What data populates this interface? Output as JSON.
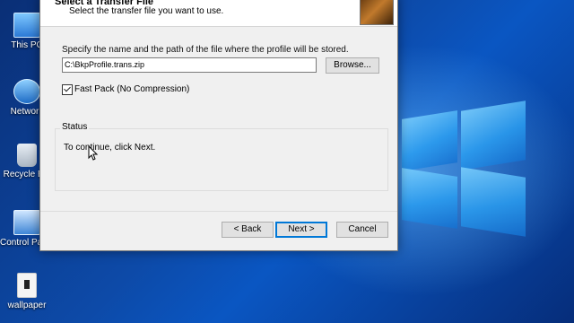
{
  "desktop": {
    "icons": [
      {
        "label": "This PC"
      },
      {
        "label": "Network"
      },
      {
        "label": "Recycle Bin"
      },
      {
        "label": "Control Panel"
      },
      {
        "label": "wallpaper"
      }
    ]
  },
  "dialog": {
    "header_title": "Select a Transfer File",
    "header_subtitle": "Select the transfer file you want to use.",
    "instruction": "Specify the name and the path of the file where the profile will be stored.",
    "path_value": "C:\\BkpProfile.trans.zip",
    "browse_label": "Browse...",
    "fast_pack_label": "Fast Pack (No Compression)",
    "fast_pack_checked": true,
    "status_legend": "Status",
    "status_text": "To continue, click Next.",
    "back_label": "< Back",
    "next_label": "Next >",
    "cancel_label": "Cancel"
  },
  "colors": {
    "accent": "#0078d7",
    "dialog_bg": "#f0f0f0"
  }
}
